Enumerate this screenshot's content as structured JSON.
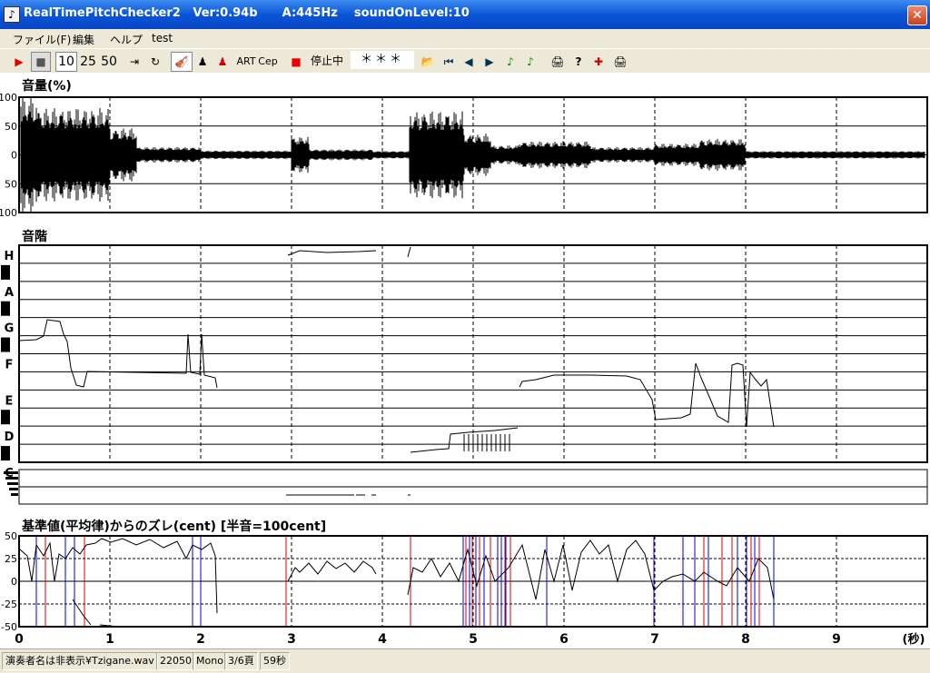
{
  "window": {
    "title": "RealTimePitchChecker2   Ver:0.94b      A:445Hz    soundOnLevel:10",
    "close_label": "✕"
  },
  "menu": [
    "ファイル(F)",
    "編集",
    "ヘルプ",
    "test"
  ],
  "toolbar": {
    "play_label": "▶",
    "stop_label": "■",
    "speed_10": "10",
    "speed_25": "25",
    "speed_50": "50",
    "art_label": "ART",
    "cep_label": "Cep",
    "status_label": "停止中",
    "display_value": "＊＊＊"
  },
  "volume_panel": {
    "title": "音量(%)",
    "y_ticks": [
      "100",
      "50",
      "0",
      "50",
      "100"
    ]
  },
  "pitch_panel": {
    "title": "音階",
    "notes": [
      "H",
      "A",
      "G",
      "F",
      "E",
      "D",
      "C"
    ]
  },
  "cent_panel": {
    "title": "基準値(平均律)からのズレ(cent) [半音=100cent]",
    "y_ticks": [
      "50",
      "25",
      "0",
      "-25",
      "-50"
    ]
  },
  "time_axis": {
    "ticks": [
      "0",
      "1",
      "2",
      "3",
      "4",
      "5",
      "6",
      "7",
      "8",
      "9"
    ],
    "unit": "(秒)"
  },
  "status": {
    "file": "演奏者名は非表示¥Tzigane.wav",
    "rate": "22050",
    "channels": "Mono",
    "page": "3/6頁",
    "duration": "59秒"
  },
  "colors": {
    "titlebar": "#0a55d8",
    "panel_bg": "#ece9d8",
    "grid": "#000000",
    "trace": "#000000",
    "cent_red": "#e00000",
    "cent_blue": "#0000e0"
  }
}
